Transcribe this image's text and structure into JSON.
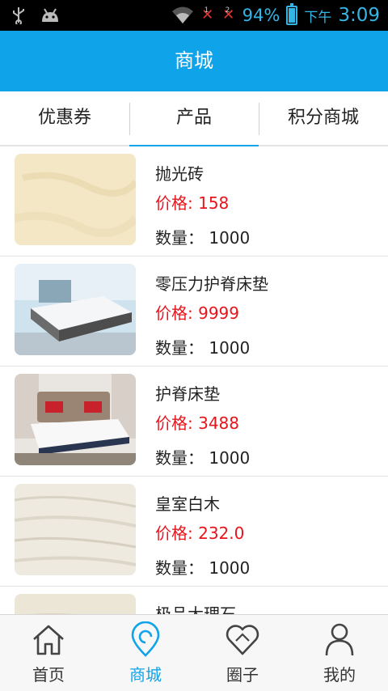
{
  "status_bar": {
    "usb_icon": "usb-icon",
    "android_icon": "android-debug-icon",
    "sim1_label": "1",
    "sim2_label": "2",
    "battery_percent": "94%",
    "ampm": "下午",
    "time": "3:09",
    "accent_color": "#33b5e5"
  },
  "header": {
    "title": "商城",
    "background_color": "#0fa3ea"
  },
  "tabs": [
    {
      "label": "优惠券",
      "active": false
    },
    {
      "label": "产品",
      "active": true
    },
    {
      "label": "积分商城",
      "active": false
    }
  ],
  "products": [
    {
      "name": "抛光砖",
      "price": "价格: 158",
      "quantity": "数量： 1000",
      "image": "beige-tile"
    },
    {
      "name": "零压力护脊床垫",
      "price": "价格: 9999",
      "quantity": "数量： 1000",
      "image": "mattress-bedroom"
    },
    {
      "name": "护脊床垫",
      "price": "价格: 3488",
      "quantity": "数量： 1000",
      "image": "mattress-bed"
    },
    {
      "name": "皇室白木",
      "price": "价格: 232.0",
      "quantity": "数量： 1000",
      "image": "white-wood-marble"
    },
    {
      "name": "极品大理石",
      "price": "",
      "quantity": "",
      "image": "marble"
    }
  ],
  "bottom_nav": [
    {
      "label": "首页",
      "icon": "home-icon",
      "active": false
    },
    {
      "label": "商城",
      "icon": "location-pin-icon",
      "active": true
    },
    {
      "label": "圈子",
      "icon": "heart-icon",
      "active": false
    },
    {
      "label": "我的",
      "icon": "person-icon",
      "active": false
    }
  ],
  "price_color": "#e8141b"
}
